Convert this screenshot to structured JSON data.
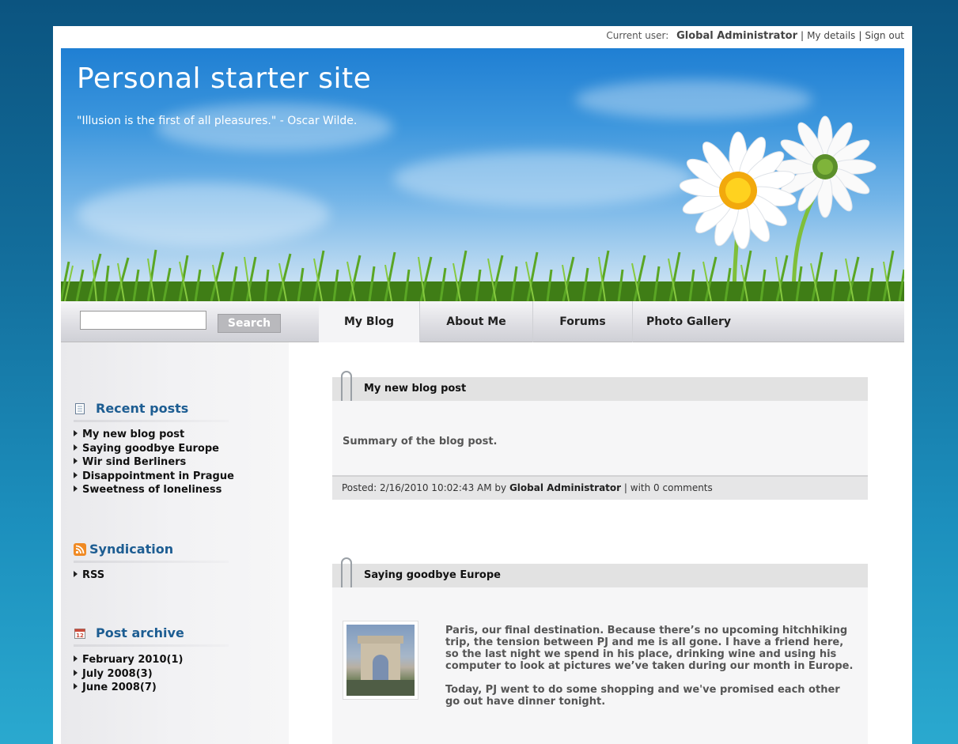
{
  "user_bar": {
    "label": "Current user:",
    "username": "Global Administrator",
    "my_details": "My details",
    "sign_out": "Sign out"
  },
  "header": {
    "title": "Personal starter site",
    "quote": "\"Illusion is the first of all pleasures.\" - Oscar Wilde."
  },
  "search": {
    "value": "",
    "button_label": "Search"
  },
  "nav": {
    "tabs": [
      {
        "label": "My Blog",
        "active": true
      },
      {
        "label": "About Me",
        "active": false
      },
      {
        "label": "Forums",
        "active": false
      },
      {
        "label": "Photo Gallery",
        "active": false
      }
    ]
  },
  "sidebar": {
    "recent_posts": {
      "title": "Recent posts",
      "icon": "document-icon",
      "items": [
        "My new blog post",
        "Saying goodbye Europe",
        "Wir sind Berliners",
        "Disappointment in Prague",
        "Sweetness of loneliness"
      ]
    },
    "syndication": {
      "title": "Syndication",
      "icon": "rss-icon",
      "items": [
        "RSS"
      ]
    },
    "post_archive": {
      "title": "Post archive",
      "icon": "calendar-icon",
      "calendar_day": "12",
      "items": [
        "February 2010(1)",
        "July 2008(3)",
        "June 2008(7)"
      ]
    }
  },
  "posts": [
    {
      "title": "My new blog post",
      "summary": "Summary of the blog post.",
      "posted_prefix": "Posted: 2/16/2010 10:02:43 AM by",
      "author": "Global Administrator",
      "comments": "| with 0 comments"
    },
    {
      "title": "Saying goodbye Europe",
      "paragraphs": [
        "Paris, our final destination. Because there’s no upcoming hitchhiking trip, the tension between PJ and me is all gone. I have a friend here, so the last night we spend in his place, drinking wine and using his computer to look at pictures we’ve taken during our month in Europe.",
        "Today, PJ went to do some shopping and we've promised each other go out have dinner tonight."
      ]
    }
  ],
  "colors": {
    "background_top": "#0b5480",
    "background_bottom": "#2aa9cf",
    "sidebar_heading": "#1d5d92",
    "post_header": "#e2e2e2"
  }
}
